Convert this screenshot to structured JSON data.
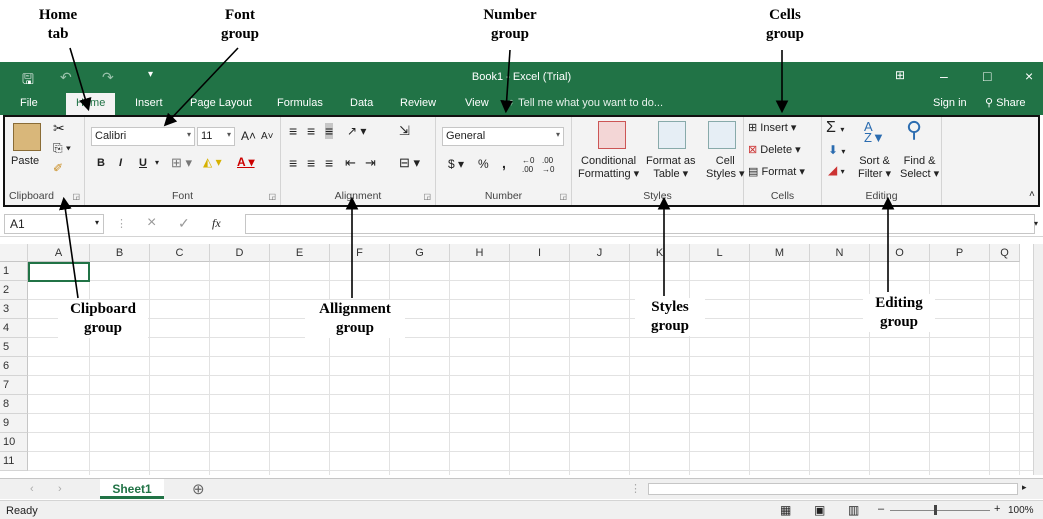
{
  "annotations": {
    "home_tab": "Home\ntab",
    "font_group": "Font\ngroup",
    "number_group": "Number\ngroup",
    "cells_group": "Cells\ngroup",
    "clipboard_group": "Clipboard\ngroup",
    "alignment_group": "Allignment\ngroup",
    "styles_group": "Styles\ngroup",
    "editing_group": "Editing\ngroup"
  },
  "titlebar": {
    "title": "Book1 - Excel (Trial)",
    "save_icon": "save-icon",
    "undo_icon": "undo-icon",
    "redo_icon": "redo-icon",
    "customize": "▾",
    "minimize": "–",
    "restore": "□",
    "close": "×"
  },
  "tabs": [
    "File",
    "Home",
    "Insert",
    "Page Layout",
    "Formulas",
    "Data",
    "Review",
    "View"
  ],
  "tell_me": "Tell me what you want to do...",
  "sign_in": "Sign in",
  "share": "Share",
  "ribbon": {
    "clipboard": {
      "label": "Clipboard",
      "paste": "Paste"
    },
    "font": {
      "label": "Font",
      "name": "Calibri",
      "size": "11",
      "bold": "B",
      "italic": "I",
      "underline": "U"
    },
    "alignment": {
      "label": "Alignment"
    },
    "number": {
      "label": "Number",
      "format": "General",
      "currency": "$",
      "percent": "%",
      "comma": ",",
      "inc_decimal": "⁰.00",
      "dec_decimal": ".00"
    },
    "styles": {
      "label": "Styles",
      "conditional_line1": "Conditional",
      "conditional_line2": "Formatting",
      "format_table_line1": "Format as",
      "format_table_line2": "Table",
      "cell_styles_line1": "Cell",
      "cell_styles_line2": "Styles"
    },
    "cells": {
      "label": "Cells",
      "insert": "Insert",
      "delete": "Delete",
      "format": "Format"
    },
    "editing": {
      "label": "Editing",
      "sort_line1": "Sort &",
      "sort_line2": "Filter",
      "find_line1": "Find &",
      "find_line2": "Select"
    }
  },
  "formula_bar": {
    "name_box": "A1",
    "fx": "fx",
    "cancel": "×",
    "enter": "✓"
  },
  "columns": [
    "A",
    "B",
    "C",
    "D",
    "E",
    "F",
    "G",
    "H",
    "I",
    "J",
    "K",
    "L",
    "M",
    "N",
    "O",
    "P",
    "Q"
  ],
  "rows": [
    "1",
    "2",
    "3",
    "4",
    "5",
    "6",
    "7",
    "8",
    "9",
    "10",
    "11"
  ],
  "sheet_tab": "Sheet1",
  "status": {
    "ready": "Ready",
    "zoom": "100%"
  },
  "colors": {
    "excel_green": "#217346",
    "ribbon_bg": "#f3f3f3"
  }
}
